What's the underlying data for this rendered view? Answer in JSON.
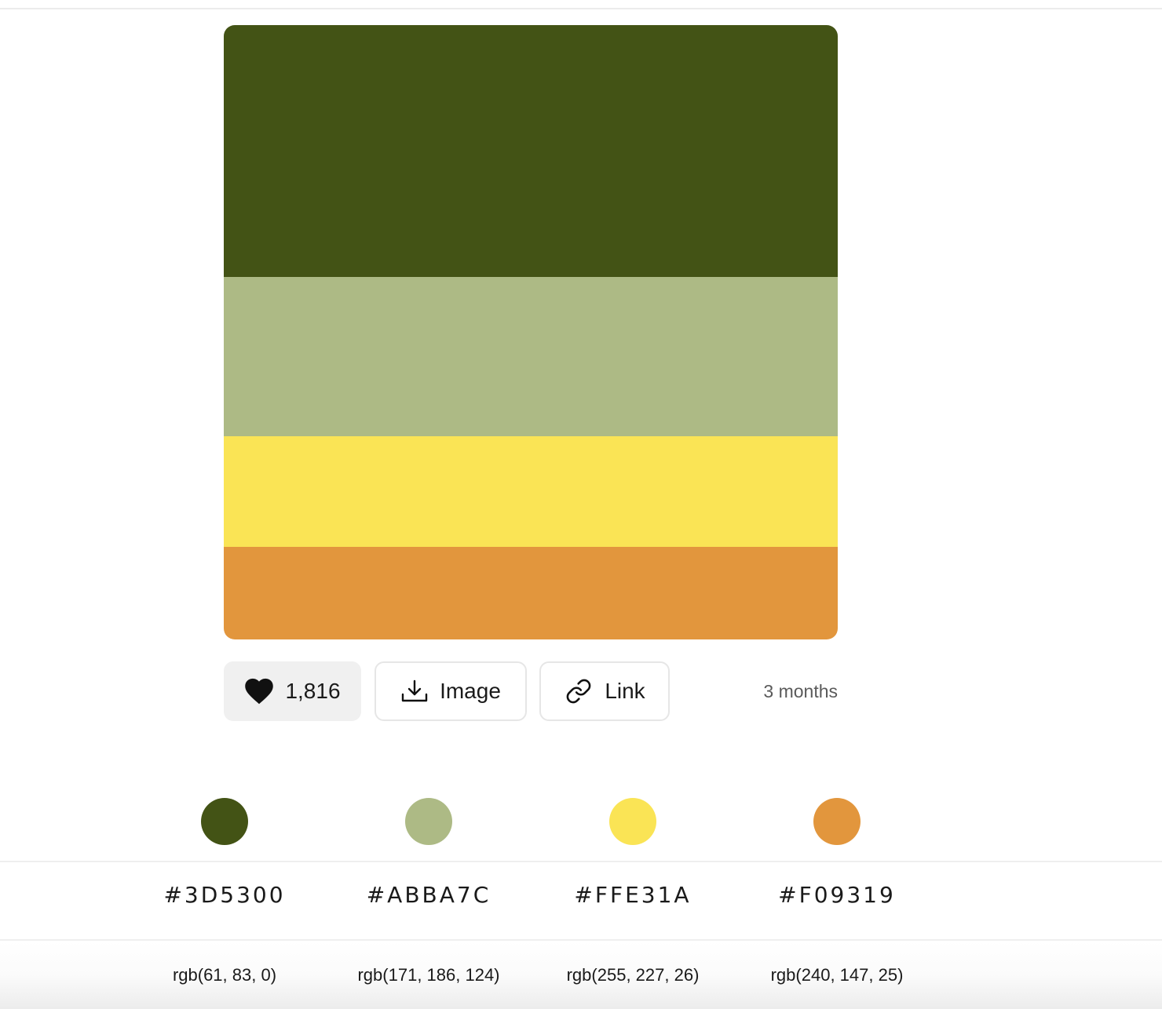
{
  "palette": {
    "colors": [
      {
        "hex": "#3D5300",
        "rgb": "rgb(61, 83, 0)",
        "color": "#435315"
      },
      {
        "hex": "#ABBA7C",
        "rgb": "rgb(171, 186, 124)",
        "color": "#ADBA85"
      },
      {
        "hex": "#FFE31A",
        "rgb": "rgb(255, 227, 26)",
        "color": "#FAE455"
      },
      {
        "hex": "#F09319",
        "rgb": "rgb(240, 147, 25)",
        "color": "#E2963D"
      }
    ]
  },
  "actions": {
    "likes": "1,816",
    "image_label": "Image",
    "link_label": "Link",
    "age": "3 months",
    "icons": {
      "like": "heart-icon",
      "image": "download-icon",
      "link": "link-icon"
    }
  }
}
